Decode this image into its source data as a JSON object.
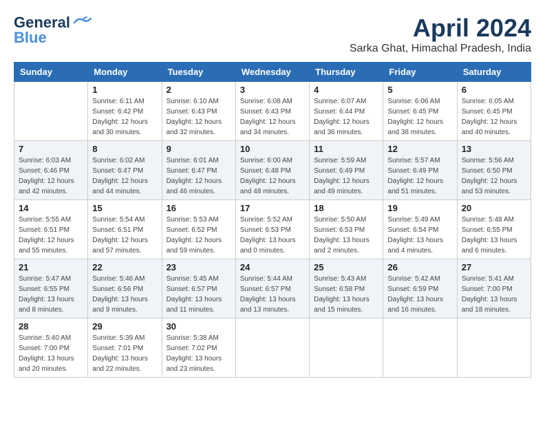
{
  "logo": {
    "line1": "General",
    "line2": "Blue"
  },
  "title": "April 2024",
  "location": "Sarka Ghat, Himachal Pradesh, India",
  "days_of_week": [
    "Sunday",
    "Monday",
    "Tuesday",
    "Wednesday",
    "Thursday",
    "Friday",
    "Saturday"
  ],
  "weeks": [
    [
      {
        "day": "",
        "empty": true
      },
      {
        "day": "1",
        "sunrise": "6:11 AM",
        "sunset": "6:42 PM",
        "daylight": "12 hours and 30 minutes."
      },
      {
        "day": "2",
        "sunrise": "6:10 AM",
        "sunset": "6:43 PM",
        "daylight": "12 hours and 32 minutes."
      },
      {
        "day": "3",
        "sunrise": "6:08 AM",
        "sunset": "6:43 PM",
        "daylight": "12 hours and 34 minutes."
      },
      {
        "day": "4",
        "sunrise": "6:07 AM",
        "sunset": "6:44 PM",
        "daylight": "12 hours and 36 minutes."
      },
      {
        "day": "5",
        "sunrise": "6:06 AM",
        "sunset": "6:45 PM",
        "daylight": "12 hours and 38 minutes."
      },
      {
        "day": "6",
        "sunrise": "6:05 AM",
        "sunset": "6:45 PM",
        "daylight": "12 hours and 40 minutes."
      }
    ],
    [
      {
        "day": "7",
        "sunrise": "6:03 AM",
        "sunset": "6:46 PM",
        "daylight": "12 hours and 42 minutes."
      },
      {
        "day": "8",
        "sunrise": "6:02 AM",
        "sunset": "6:47 PM",
        "daylight": "12 hours and 44 minutes."
      },
      {
        "day": "9",
        "sunrise": "6:01 AM",
        "sunset": "6:47 PM",
        "daylight": "12 hours and 46 minutes."
      },
      {
        "day": "10",
        "sunrise": "6:00 AM",
        "sunset": "6:48 PM",
        "daylight": "12 hours and 48 minutes."
      },
      {
        "day": "11",
        "sunrise": "5:59 AM",
        "sunset": "6:49 PM",
        "daylight": "12 hours and 49 minutes."
      },
      {
        "day": "12",
        "sunrise": "5:57 AM",
        "sunset": "6:49 PM",
        "daylight": "12 hours and 51 minutes."
      },
      {
        "day": "13",
        "sunrise": "5:56 AM",
        "sunset": "6:50 PM",
        "daylight": "12 hours and 53 minutes."
      }
    ],
    [
      {
        "day": "14",
        "sunrise": "5:55 AM",
        "sunset": "6:51 PM",
        "daylight": "12 hours and 55 minutes."
      },
      {
        "day": "15",
        "sunrise": "5:54 AM",
        "sunset": "6:51 PM",
        "daylight": "12 hours and 57 minutes."
      },
      {
        "day": "16",
        "sunrise": "5:53 AM",
        "sunset": "6:52 PM",
        "daylight": "12 hours and 59 minutes."
      },
      {
        "day": "17",
        "sunrise": "5:52 AM",
        "sunset": "6:53 PM",
        "daylight": "13 hours and 0 minutes."
      },
      {
        "day": "18",
        "sunrise": "5:50 AM",
        "sunset": "6:53 PM",
        "daylight": "13 hours and 2 minutes."
      },
      {
        "day": "19",
        "sunrise": "5:49 AM",
        "sunset": "6:54 PM",
        "daylight": "13 hours and 4 minutes."
      },
      {
        "day": "20",
        "sunrise": "5:48 AM",
        "sunset": "6:55 PM",
        "daylight": "13 hours and 6 minutes."
      }
    ],
    [
      {
        "day": "21",
        "sunrise": "5:47 AM",
        "sunset": "6:55 PM",
        "daylight": "13 hours and 8 minutes."
      },
      {
        "day": "22",
        "sunrise": "5:46 AM",
        "sunset": "6:56 PM",
        "daylight": "13 hours and 9 minutes."
      },
      {
        "day": "23",
        "sunrise": "5:45 AM",
        "sunset": "6:57 PM",
        "daylight": "13 hours and 11 minutes."
      },
      {
        "day": "24",
        "sunrise": "5:44 AM",
        "sunset": "6:57 PM",
        "daylight": "13 hours and 13 minutes."
      },
      {
        "day": "25",
        "sunrise": "5:43 AM",
        "sunset": "6:58 PM",
        "daylight": "13 hours and 15 minutes."
      },
      {
        "day": "26",
        "sunrise": "5:42 AM",
        "sunset": "6:59 PM",
        "daylight": "13 hours and 16 minutes."
      },
      {
        "day": "27",
        "sunrise": "5:41 AM",
        "sunset": "7:00 PM",
        "daylight": "13 hours and 18 minutes."
      }
    ],
    [
      {
        "day": "28",
        "sunrise": "5:40 AM",
        "sunset": "7:00 PM",
        "daylight": "13 hours and 20 minutes."
      },
      {
        "day": "29",
        "sunrise": "5:39 AM",
        "sunset": "7:01 PM",
        "daylight": "13 hours and 22 minutes."
      },
      {
        "day": "30",
        "sunrise": "5:38 AM",
        "sunset": "7:02 PM",
        "daylight": "13 hours and 23 minutes."
      },
      {
        "day": "",
        "empty": true
      },
      {
        "day": "",
        "empty": true
      },
      {
        "day": "",
        "empty": true
      },
      {
        "day": "",
        "empty": true
      }
    ]
  ],
  "labels": {
    "sunrise_prefix": "Sunrise: ",
    "sunset_prefix": "Sunset: ",
    "daylight_prefix": "Daylight: "
  }
}
